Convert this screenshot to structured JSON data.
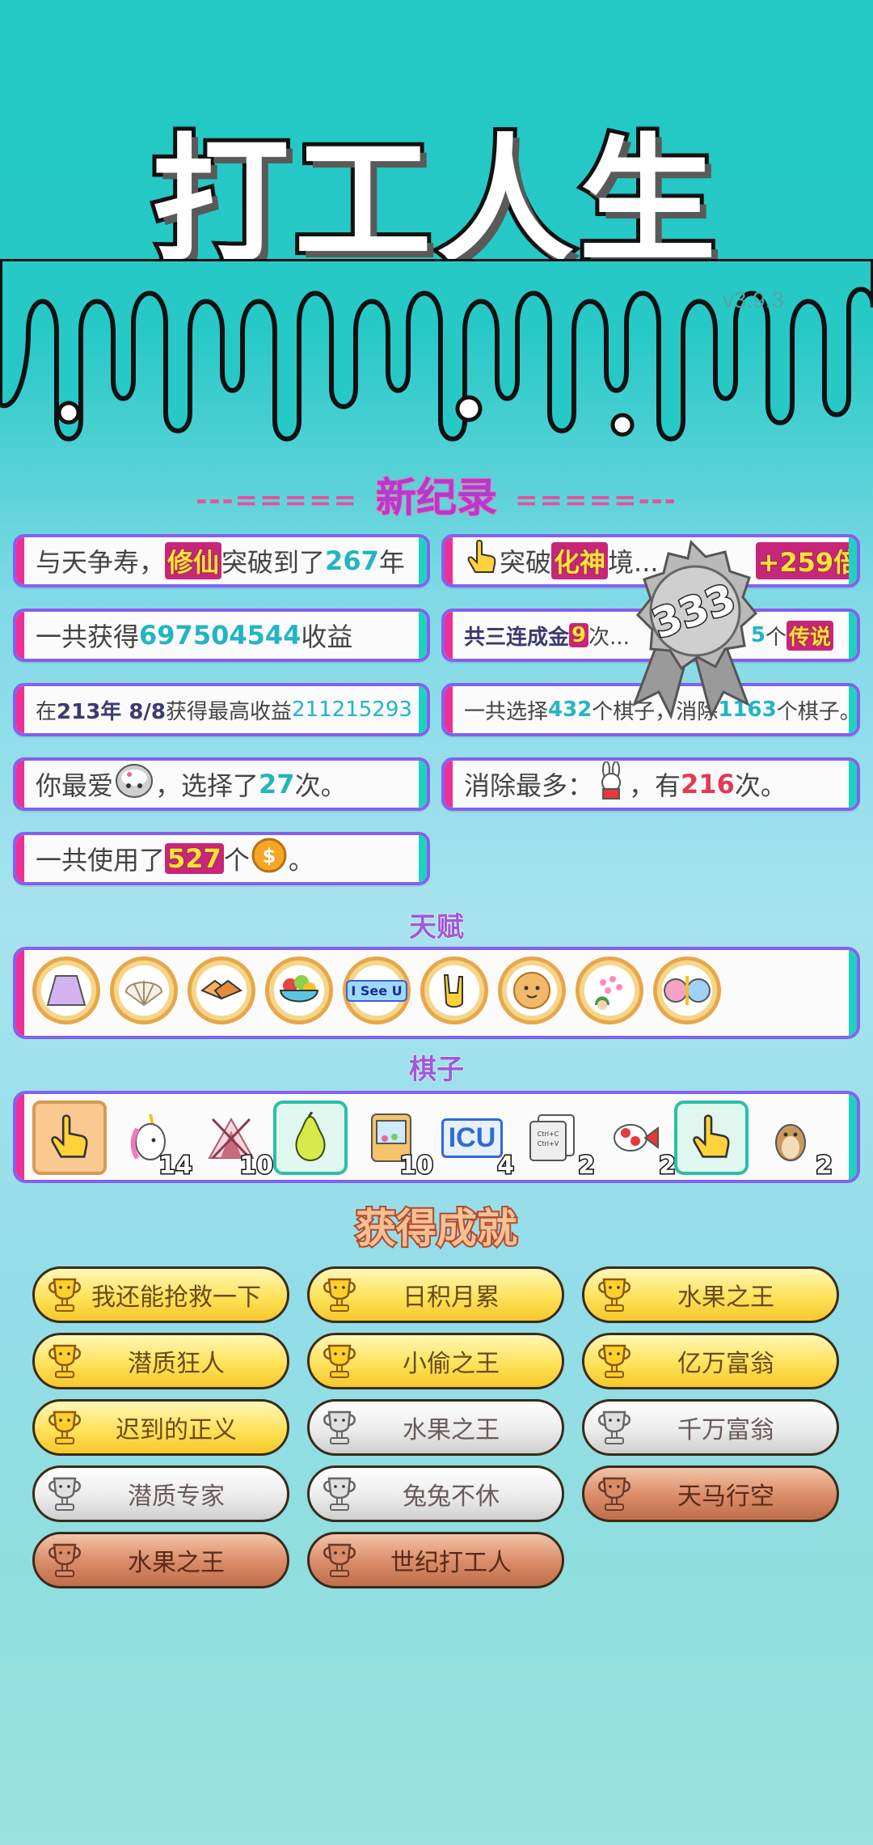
{
  "header": {
    "title": "打工人生",
    "version": "v3.9.3"
  },
  "new_records": {
    "title": "新纪录",
    "dash_left": "---=====",
    "dash_right": "=====---",
    "cards": {
      "c1": {
        "p1": "与天争寿，",
        "h1": "修仙",
        "p2": "突破到了",
        "h2": "267",
        "p3": "年"
      },
      "c2": {
        "p1": "突破",
        "h1": "化神",
        "p2": "境...",
        "h2": "+259倍"
      },
      "c3": {
        "p1": "一共获得",
        "h1": "697504544",
        "p2": "收益"
      },
      "c4": {
        "p1": "共三连成金",
        "h1": "9",
        "p2": "次...",
        "h2": "5",
        "p3": "个",
        "h3": "传说"
      },
      "c5": {
        "p1": "在 ",
        "h1": "213年 8/8",
        "p2": " 获得最高收益",
        "h2": "211215293"
      },
      "c6": {
        "p1": "一共选择",
        "h1": "432",
        "p2": "个棋子，消除",
        "h2": "1163",
        "p3": "个棋子。"
      },
      "c7": {
        "p1": "你最爱",
        "p2": "，选择了",
        "h1": "27",
        "p3": "次。"
      },
      "c8": {
        "p1": "消除最多：",
        "p2": "，有",
        "h1": "216",
        "p3": "次。"
      },
      "c9": {
        "p1": "一共使用了",
        "h1": "527",
        "p2": "个",
        "p3": "。"
      }
    },
    "medal_number": "333"
  },
  "talents": {
    "title": "天赋",
    "items": [
      "skirt-icon",
      "shell-icon",
      "handshake-icon",
      "fruit-bowl-icon",
      "i-see-u-icon",
      "rock-hand-icon",
      "cookie-icon",
      "blossom-tree-icon",
      "ice-cream-icon"
    ],
    "see_u_text": "I See U"
  },
  "pieces": {
    "title": "棋子",
    "items": [
      {
        "icon": "hand-pointer-icon",
        "count": ""
      },
      {
        "icon": "unicorn-icon",
        "count": "14"
      },
      {
        "icon": "tent-icon",
        "count": "10"
      },
      {
        "icon": "pomelo-icon",
        "count": ""
      },
      {
        "icon": "claw-machine-icon",
        "count": "10"
      },
      {
        "icon": "icu-icon",
        "count": "4",
        "text": "ICU"
      },
      {
        "icon": "copy-paste-icon",
        "count": "2"
      },
      {
        "icon": "koi-fish-icon",
        "count": "2"
      },
      {
        "icon": "hand-pointer-icon",
        "count": ""
      },
      {
        "icon": "marmot-icon",
        "count": "2"
      }
    ]
  },
  "achievements": {
    "title": "获得成就",
    "items": [
      {
        "label": "我还能抢救一下",
        "tier": "gold"
      },
      {
        "label": "日积月累",
        "tier": "gold"
      },
      {
        "label": "水果之王",
        "tier": "gold"
      },
      {
        "label": "潜质狂人",
        "tier": "gold"
      },
      {
        "label": "小偷之王",
        "tier": "gold"
      },
      {
        "label": "亿万富翁",
        "tier": "gold"
      },
      {
        "label": "迟到的正义",
        "tier": "gold"
      },
      {
        "label": "水果之王",
        "tier": "silver"
      },
      {
        "label": "千万富翁",
        "tier": "silver"
      },
      {
        "label": "潜质专家",
        "tier": "silver"
      },
      {
        "label": "兔兔不休",
        "tier": "silver"
      },
      {
        "label": "天马行空",
        "tier": "bronze"
      },
      {
        "label": "水果之王",
        "tier": "bronze"
      },
      {
        "label": "世纪打工人",
        "tier": "bronze"
      }
    ]
  },
  "colors": {
    "accent_pink": "#ef2e96",
    "accent_teal": "#1fd2c0",
    "border_purple": "#8460f0",
    "highlight_teal": "#22b5c3",
    "highlight_red": "#e33a55"
  }
}
